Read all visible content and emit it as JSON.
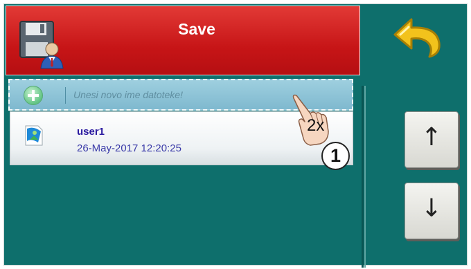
{
  "header": {
    "title": "Save"
  },
  "new_file": {
    "placeholder": "Unesi novo ime datoteke!"
  },
  "files": [
    {
      "name": "user1",
      "date": "26-May-2017 12:20:25"
    }
  ],
  "annotation": {
    "tap_count": "2x",
    "step": "1"
  },
  "nav": {
    "up_glyph": "↑",
    "down_glyph": "↓"
  },
  "icons": {
    "save": "floppy-disk-user-icon",
    "back": "back-arrow-icon",
    "add": "plus-circle-icon",
    "file": "user-file-icon",
    "tap": "hand-pointer-icon"
  },
  "colors": {
    "background": "#0e6f6c",
    "header": "#c71517",
    "new_row": "#8fc3d7",
    "back_arrow": "#f2c21c"
  }
}
